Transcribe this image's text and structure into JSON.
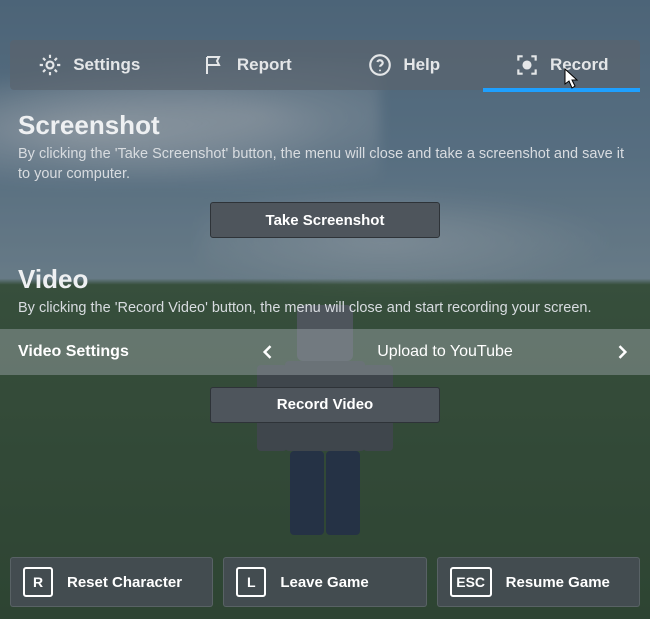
{
  "tabs": {
    "settings": "Settings",
    "report": "Report",
    "help": "Help",
    "record": "Record",
    "active": "record"
  },
  "screenshot": {
    "title": "Screenshot",
    "desc": "By clicking the 'Take Screenshot' button, the menu will close and take a screenshot and save it to your computer.",
    "button": "Take Screenshot"
  },
  "video": {
    "title": "Video",
    "desc": "By clicking the 'Record Video' button, the menu will close and start recording your screen.",
    "settings_label": "Video Settings",
    "upload_option": "Upload to YouTube",
    "button": "Record Video"
  },
  "bottom": {
    "reset": {
      "key": "R",
      "label": "Reset Character"
    },
    "leave": {
      "key": "L",
      "label": "Leave Game"
    },
    "resume": {
      "key": "ESC",
      "label": "Resume Game"
    }
  }
}
